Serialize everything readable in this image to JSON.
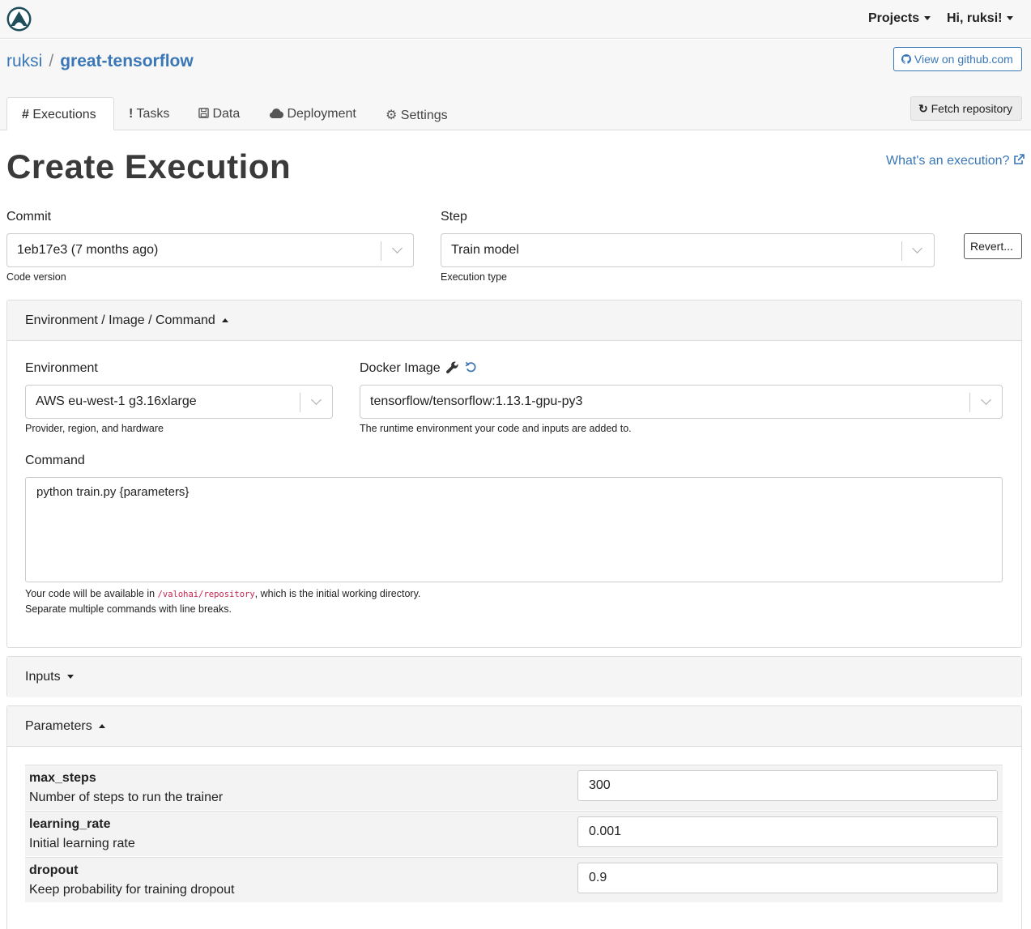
{
  "nav": {
    "projects_label": "Projects",
    "user_label": "Hi, ruksi!"
  },
  "breadcrumb": {
    "owner": "ruksi",
    "separator": "/",
    "repo": "great-tensorflow"
  },
  "header_buttons": {
    "github": "View on github.com",
    "fetch": "Fetch repository"
  },
  "tabs": [
    {
      "icon": "#",
      "label": "Executions"
    },
    {
      "icon": "!",
      "label": "Tasks"
    },
    {
      "icon": "save-icon",
      "label": "Data"
    },
    {
      "icon": "cloud-icon",
      "label": "Deployment"
    },
    {
      "icon": "gear-icon",
      "label": "Settings"
    }
  ],
  "page": {
    "title": "Create Execution",
    "help_link": "What's an execution?"
  },
  "commit": {
    "label": "Commit",
    "value": "1eb17e3 (7 months ago)",
    "help": "Code version"
  },
  "step": {
    "label": "Step",
    "value": "Train model",
    "help": "Execution type"
  },
  "revert_label": "Revert...",
  "env_panel": {
    "title": "Environment / Image / Command",
    "environment": {
      "label": "Environment",
      "value": "AWS eu-west-1 g3.16xlarge",
      "help": "Provider, region, and hardware"
    },
    "docker": {
      "label": "Docker Image",
      "value": "tensorflow/tensorflow:1.13.1-gpu-py3",
      "help": "The runtime environment your code and inputs are added to."
    },
    "command": {
      "label": "Command",
      "value": "python train.py {parameters}",
      "help_prefix": "Your code will be available in ",
      "help_path": "/valohai/repository",
      "help_suffix": ", which is the initial working directory.",
      "help_line2": "Separate multiple commands with line breaks."
    }
  },
  "inputs_panel": {
    "title": "Inputs"
  },
  "params_panel": {
    "title": "Parameters",
    "rows": [
      {
        "name": "max_steps",
        "desc": "Number of steps to run the trainer",
        "value": "300"
      },
      {
        "name": "learning_rate",
        "desc": "Initial learning rate",
        "value": "0.001"
      },
      {
        "name": "dropout",
        "desc": "Keep probability for training dropout",
        "value": "0.9"
      }
    ]
  },
  "colors": {
    "accent": "#3a77b7",
    "logo": "#1f4e5a",
    "code_path": "#c7254e"
  }
}
